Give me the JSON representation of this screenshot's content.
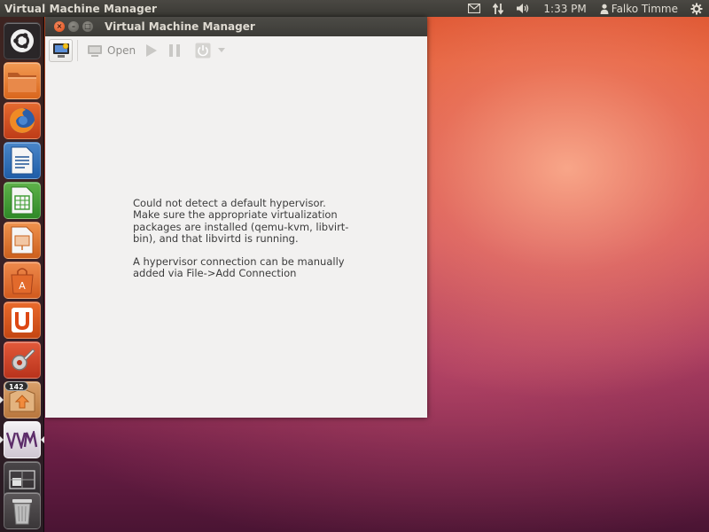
{
  "top_panel": {
    "app_title": "Virtual Machine Manager",
    "clock": "1:33 PM",
    "user": "Falko Timme",
    "icons": [
      "mail-icon",
      "network-icon",
      "volume-icon",
      "user-icon",
      "settings-gear-icon"
    ]
  },
  "launcher": {
    "items": [
      {
        "name": "dash-home",
        "icon": "ubuntu-logo-icon"
      },
      {
        "name": "files",
        "icon": "folder-icon"
      },
      {
        "name": "firefox",
        "icon": "firefox-icon"
      },
      {
        "name": "libreoffice-writer",
        "icon": "writer-icon"
      },
      {
        "name": "libreoffice-calc",
        "icon": "calc-icon"
      },
      {
        "name": "libreoffice-impress",
        "icon": "impress-icon"
      },
      {
        "name": "ubuntu-software-center",
        "icon": "shopping-bag-icon"
      },
      {
        "name": "ubuntu-one",
        "icon": "ubuntu-one-icon"
      },
      {
        "name": "system-settings",
        "icon": "settings-icon"
      },
      {
        "name": "update-manager",
        "icon": "update-icon",
        "badge": "142"
      },
      {
        "name": "virt-manager",
        "icon": "vmm-icon"
      },
      {
        "name": "workspace-switcher",
        "icon": "workspaces-icon"
      },
      {
        "name": "trash",
        "icon": "trash-icon"
      }
    ]
  },
  "window": {
    "title": "Virtual Machine Manager",
    "toolbar": {
      "open_label": "Open"
    },
    "message": {
      "line1": "Could not detect a default hypervisor. Make sure the appropriate virtualization packages are installed (qemu-kvm, libvirt-bin), and that libvirtd is running.",
      "line2": "A hypervisor connection can be manually added via File->Add Connection"
    }
  },
  "colors": {
    "panel_bg": "#3c3b37",
    "window_bg": "#f2f1f0",
    "close_button": "#df4b16",
    "text": "#3c3c3c"
  }
}
